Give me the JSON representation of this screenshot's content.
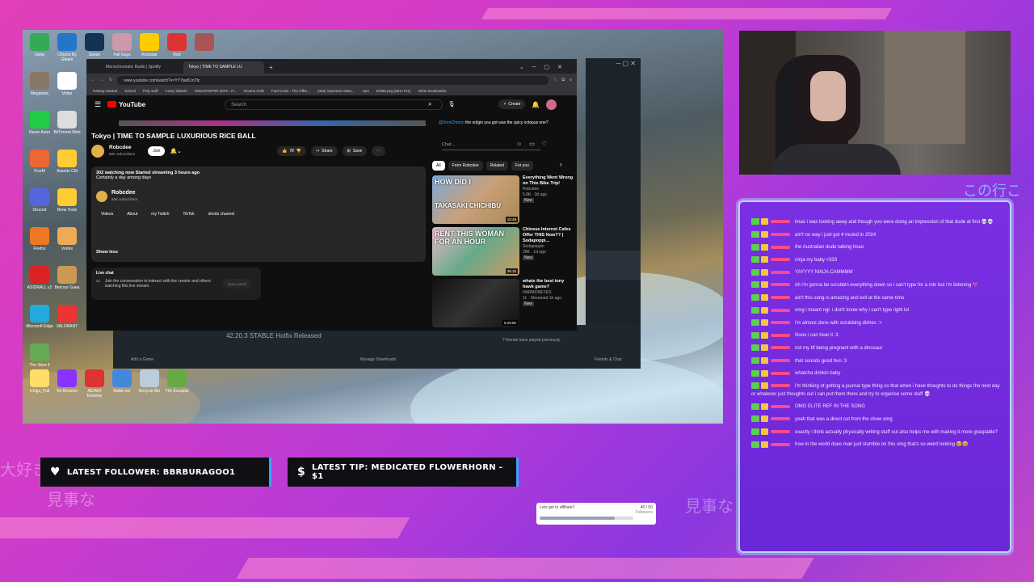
{
  "browser": {
    "tabs": [
      "Monochromatic Radio | Spotify",
      "Tokyo | TIME TO SAMPLE LU"
    ],
    "url": "www.youtube.com/watch?v=YY7tadCmTtc",
    "bookmarks": [
      "Getting Started",
      "School",
      "Poly stuff",
      "Crazy Islands",
      "SODAPOPPIN GIFS - P...",
      "Gnome trolls",
      "Fuel Crisis - The Offici...",
      "(445) important video...",
      "cars",
      "EGB8.png (651×721)",
      "Other Bookmarks"
    ]
  },
  "youtube": {
    "logo": "YouTube",
    "search_placeholder": "Search",
    "create_label": "Create",
    "video_title": "Tokyo | TIME TO SAMPLE LUXURIOUS RICE BALL",
    "channel": "Robcdee",
    "subscribers": "80K subscribers",
    "join": "Join",
    "likes": "78",
    "share": "Share",
    "save": "Save",
    "stats": "302 watching now  Started streaming 3 hours ago",
    "desc_line": "Certainly a day among days",
    "desc_channel": "Robcdee",
    "desc_subs": "80K subscribers",
    "links": [
      "Videos",
      "About",
      "my Twitch",
      "TikTok",
      "shorts channel"
    ],
    "show_less": "Show less",
    "live_chat_title": "Live chat",
    "live_chat_text": "Join the conversation to interact with the creator and others watching this live stream.",
    "open_panel": "Open panel",
    "chat_user": "@ZeroChrono",
    "chat_msg": "the ori|gin you got was the spicy octopus one?",
    "chat_placeholder": "Chat...",
    "chips": [
      "All",
      "From Robcdee",
      "Related",
      "For you"
    ],
    "recs": [
      {
        "title": "Everything Went Wrong on This Bike Trip!",
        "channel": "Robcdee",
        "meta": "5.8K · 3d ago",
        "badge": "New",
        "duration": "18:49",
        "thumb_text": "HOW DID I",
        "thumb_text2": "TAKASAKI CHICHIBU"
      },
      {
        "title": "Chinese Internet Cafes Offer THIS Now?? | Sodapoppi...",
        "channel": "Sodapoppin",
        "meta": "29K · 1d ago",
        "badge": "New",
        "duration": "36:15",
        "thumb_text": "RENT THIS WOMAN FOR AN HOUR"
      },
      {
        "title": "whats the best tony hawk game?",
        "channel": "HARMONEYES",
        "meta": "11 · Streamed 1h ago",
        "badge": "New",
        "duration": "5:29:50"
      }
    ]
  },
  "launcher": {
    "version": "42.20.3 STABLE Hotfix Released",
    "add_game": "Add a Game",
    "manage_downloads": "Manage Downloads",
    "friends_chat": "Friends & Chat",
    "friends_played": "7 friends have played previously"
  },
  "desktop_icons": [
    "Gimp",
    "Chrono By Gleam",
    "Steam",
    "Fall Guys",
    "Rockstar",
    "Red",
    "",
    "Megamax",
    "Video",
    "Razer Axon",
    "BitTorrent Web",
    "FiveM",
    "Assetto CM",
    "Discord",
    "Brew Tools",
    "Firefox",
    "Vortex",
    "ASIDRALL v2",
    "Betcour Gaea",
    "Microsoft Edge",
    "VALORANT",
    "The Sims 4",
    "Ichigo_Full",
    "Tor Browser",
    "AIDA64 Extreme",
    "Battle.net",
    "Recycle Bin",
    "The Escapist"
  ],
  "chat": {
    "messages": [
      "lmao i was looking away and though you were doing an impression of that dude at first 💀💀",
      "ain't no way i just got 4 muted in 2024",
      "the Australian dude talking lmao",
      "ninja my baby <333",
      "YAYYYY NINJA CAMMMM",
      "oh i'm gonna be scrubbin everything down so i can't type for a min but i'm listening 💜",
      "ain't this song is amazing and evil at the same time",
      "omg i meant ngl. i don't know why i can't type right lol",
      "i'm almost done with scrubbing dishes :>",
      "Nooo i can hear it :3",
      "not my bf being pregnant with a dinosaur",
      "that sounds good hun :3",
      "whatcha drinkin baby",
      "i'm thinking of getting a journal type thing so that when i have thoughts to do things the next day or whatever just thoughts out i can put them there and try to organise some stuff 💀",
      "OMG ELITE REF IN THE SONG",
      "yeah that was a direct cut from the show omg",
      "exactly i think actually physically writing stuff out also helps me with making it more graspable?",
      "how in the world does man just stumble on this omg that's so weird looking 😆😆"
    ]
  },
  "overlay": {
    "latest_follower": "LATEST FOLLOWER: BBRBURAGOO1",
    "latest_tip": "LATEST TIP: MEDICATED FLOWERHORN - $1",
    "goal_label": "Lets get to affiliate!!",
    "goal_count": "40 / 50",
    "goal_unit": "Followers",
    "goal_progress": 0.8,
    "jp_text_1": "大好き",
    "jp_text_2": "見事な",
    "jp_text_3": "見事な",
    "jp_text_4": "この行こ",
    "accent": "#3aa3ff"
  }
}
